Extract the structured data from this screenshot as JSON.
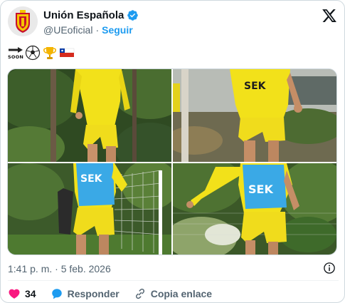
{
  "account": {
    "display_name": "Unión Española",
    "handle": "@UEoficial",
    "separator": "·",
    "follow_label": "Seguir",
    "verified_color": "#1d9bf0"
  },
  "tweet": {
    "emoji_text": [
      "SOON",
      "soccer-ball",
      "trophy",
      "flag-chile"
    ],
    "soon_label": "SOON",
    "timestamp": "1:41 p. m. · 5 feb. 2026",
    "media": [
      {
        "name": "photo-1",
        "description_icon": "player-yellow-kit"
      },
      {
        "name": "photo-2",
        "description_icon": "player-yellow-kit"
      },
      {
        "name": "photo-3",
        "description_icon": "player-blue-bib"
      },
      {
        "name": "photo-4",
        "description_icon": "player-blue-bib"
      }
    ]
  },
  "actions": {
    "like_count": "34",
    "reply_label": "Responder",
    "copy_label": "Copia enlace"
  },
  "colors": {
    "like": "#f91880",
    "reply": "#1d9bf0",
    "muted": "#536471",
    "accent": "#1d9bf0",
    "kit_yellow": "#f2e11a",
    "bib_blue": "#3aa9e6"
  }
}
